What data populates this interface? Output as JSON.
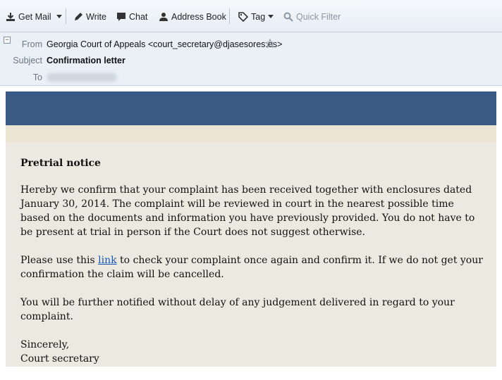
{
  "toolbar": {
    "get_mail": "Get Mail",
    "write": "Write",
    "chat": "Chat",
    "address_book": "Address Book",
    "tag": "Tag",
    "quick_filter": "Quick Filter"
  },
  "header": {
    "from_label": "From",
    "from_value": "Georgia Court of Appeals <court_secretary@djasesores.es>",
    "subject_label": "Subject",
    "subject_value": "Confirmation letter",
    "to_label": "To"
  },
  "message": {
    "heading": "Pretrial notice",
    "para1": "Hereby we confirm that your complaint has been received together with enclosures dated January 30, 2014. The complaint will be reviewed in court in the nearest possible time based on the documents and information you have previously provided. You do not have to be present at trial in person if the Court does not suggest otherwise.",
    "para2_before": "Please use this ",
    "para2_link": "link",
    "para2_after": " to check your complaint once again and confirm it. If we do not get your confirmation the claim will be cancelled.",
    "para3": "You will be further notified without delay of any judgement delivered in regard to your complaint.",
    "closing": "Sincerely,",
    "signature": "Court secretary"
  },
  "colors": {
    "banner": "#3a5a86",
    "strip": "#ece4d2",
    "body_bg": "#ebe9e0",
    "link": "#1a57b5"
  }
}
